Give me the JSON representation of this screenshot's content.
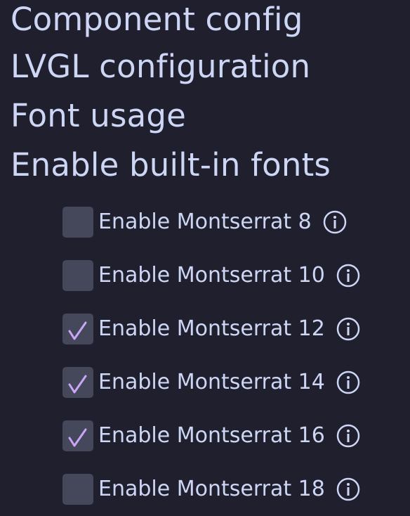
{
  "breadcrumbs": [
    "Component config",
    "LVGL configuration",
    "Font usage",
    "Enable built-in fonts"
  ],
  "options": [
    {
      "label": "Enable Montserrat 8",
      "checked": false,
      "icon": "info-icon"
    },
    {
      "label": "Enable Montserrat 10",
      "checked": false,
      "icon": "info-icon"
    },
    {
      "label": "Enable Montserrat 12",
      "checked": true,
      "icon": "info-icon"
    },
    {
      "label": "Enable Montserrat 14",
      "checked": true,
      "icon": "info-icon"
    },
    {
      "label": "Enable Montserrat 16",
      "checked": true,
      "icon": "info-icon"
    },
    {
      "label": "Enable Montserrat 18",
      "checked": false,
      "icon": "info-icon"
    }
  ],
  "colors": {
    "background": "#1f1f2e",
    "text": "#cdd6f4",
    "checkbox": "#45475a",
    "checkmark": "#cba6f7"
  }
}
